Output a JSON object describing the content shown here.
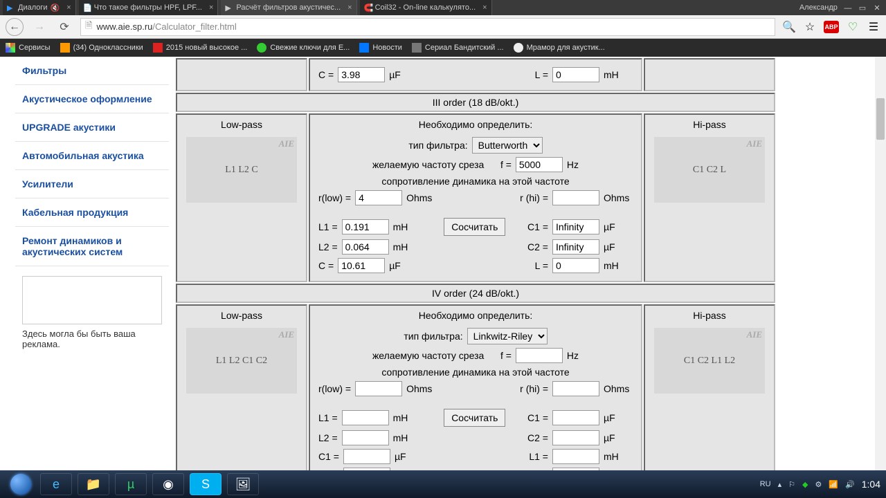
{
  "os_tabs": [
    {
      "label": "Диалоги"
    },
    {
      "label": "Что такое фильтры HPF, LPF..."
    },
    {
      "label": "Расчёт фильтров акустичес...",
      "active": true
    },
    {
      "label": "Coil32 - On-line калькулято..."
    }
  ],
  "os_user": "Александр",
  "url_domain": "www.aie.sp.ru",
  "url_path": "/Calculator_filter.html",
  "bookmarks": [
    {
      "label": "Сервисы",
      "color": "#f33"
    },
    {
      "label": "(34) Одноклассники",
      "color": "#f90"
    },
    {
      "label": "2015 новый высокое ...",
      "color": "#d22"
    },
    {
      "label": "Свежие ключи для E...",
      "color": "#3c3"
    },
    {
      "label": "Новости",
      "color": "#07f"
    },
    {
      "label": "Сериал Бандитский ...",
      "color": "#777"
    },
    {
      "label": "Мрамор для акустик...",
      "color": "#eee"
    }
  ],
  "sidebar": {
    "items": [
      "Фильтры",
      "Акустическое оформление",
      "UPGRADE акустики",
      "Автомобильная акустика",
      "Усилители",
      "Кабельная продукция",
      "Ремонт динамиков и акустических систем"
    ],
    "ad_text": "Здесь могла бы быть ваша реклама."
  },
  "labels": {
    "lowpass": "Low-pass",
    "hipass": "Hi-pass",
    "define": "Необходимо определить:",
    "filter_type": "тип фильтра:",
    "freq_text": "желаемую частоту среза",
    "f_eq": "f =",
    "hz": "Hz",
    "imp_text": "сопротивление динамика на этой частоте",
    "rlow": "r(low) =",
    "rhi": "r (hi) =",
    "ohms": "Ohms",
    "calc": "Сосчитать",
    "L1": "L1 =",
    "L2": "L2 =",
    "C": "C =",
    "L": "L =",
    "C1": "C1 =",
    "C2": "C2 =",
    "mH": "mH",
    "uF": "µF"
  },
  "top_remnant": {
    "C": "3.98",
    "L": "0"
  },
  "order3": {
    "header": "III order (18 dB/okt.)",
    "filter_type": "Butterworth",
    "f": "5000",
    "rlow": "4",
    "rhi": "",
    "L1": "0.191",
    "L2": "0.064",
    "C": "10.61",
    "C1": "Infinity",
    "C2": "Infinity",
    "L": "0",
    "schem_low": "L1  L2  C",
    "schem_hi": "C1  C2  L"
  },
  "order4": {
    "header": "IV order (24 dB/okt.)",
    "filter_type": "Linkwitz-Riley",
    "f": "",
    "rlow": "",
    "rhi": "",
    "L1": "",
    "L2": "",
    "C1l": "",
    "C2l": "",
    "C1": "",
    "C2": "",
    "L1r": "",
    "L2r": "",
    "schem_low": "L1  L2 C1 C2",
    "schem_hi": "C1  C2 L1 L2"
  },
  "tray": {
    "lang": "RU",
    "time": "1:04"
  }
}
